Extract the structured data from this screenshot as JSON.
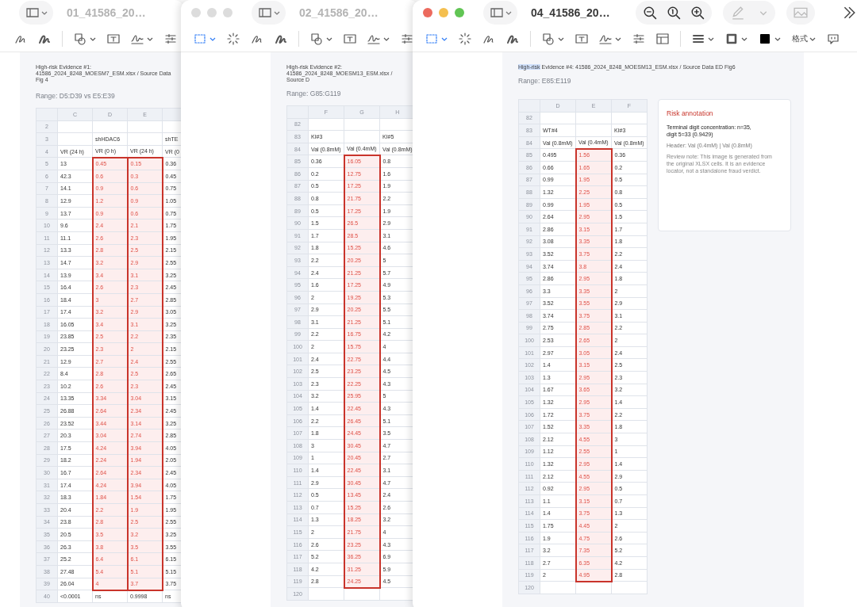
{
  "windows": [
    {
      "title": "01_41586_20…",
      "active": false,
      "evidence": {
        "text": "High-risk Evidence #1: 41586_2024_8248_MOESM7_ESM.xlsx / Source Data Fig 4"
      },
      "range": "Range: D5:D39 vs E5:E39",
      "table": {
        "columns": [
          {
            "letter": "C",
            "flagged": false
          },
          {
            "letter": "D",
            "flagged": true
          },
          {
            "letter": "E",
            "flagged": true
          },
          {
            "flagged": false
          }
        ],
        "rows": [
          {
            "n": "2",
            "flagged": false,
            "cells": [
              null,
              null,
              null,
              null
            ]
          },
          {
            "n": "3",
            "flagged": false,
            "cells": [
              null,
              "shHDAC6",
              null,
              "shTE"
            ]
          },
          {
            "n": "4",
            "flagged": false,
            "cells": [
              "VR (24 h)",
              "VR (0 h)",
              "VR (24 h)",
              "VR (0"
            ]
          },
          {
            "n": "5",
            "flagged": true,
            "cells": [
              "13",
              "0.45",
              "0.15",
              "0.36"
            ]
          },
          {
            "n": "6",
            "flagged": true,
            "cells": [
              "42.3",
              "0.6",
              "0.3",
              "0.45"
            ]
          },
          {
            "n": "7",
            "flagged": true,
            "cells": [
              "14.1",
              "0.9",
              "0.6",
              "0.75"
            ]
          },
          {
            "n": "8",
            "flagged": true,
            "cells": [
              "12.9",
              "1.2",
              "0.9",
              "1.05"
            ]
          },
          {
            "n": "9",
            "flagged": true,
            "cells": [
              "13.7",
              "0.9",
              "0.6",
              "0.75"
            ]
          },
          {
            "n": "10",
            "flagged": true,
            "cells": [
              "9.6",
              "2.4",
              "2.1",
              "1.75"
            ]
          },
          {
            "n": "11",
            "flagged": true,
            "cells": [
              "11.1",
              "2.6",
              "2.3",
              "1.95"
            ]
          },
          {
            "n": "12",
            "flagged": true,
            "cells": [
              "13.3",
              "2.8",
              "2.5",
              "2.15"
            ]
          },
          {
            "n": "13",
            "flagged": true,
            "cells": [
              "14.7",
              "3.2",
              "2.9",
              "2.55"
            ]
          },
          {
            "n": "14",
            "flagged": true,
            "cells": [
              "13.9",
              "3.4",
              "3.1",
              "3.25"
            ]
          },
          {
            "n": "15",
            "flagged": true,
            "cells": [
              "16.4",
              "2.6",
              "2.3",
              "2.45"
            ]
          },
          {
            "n": "16",
            "flagged": true,
            "cells": [
              "18.4",
              "3",
              "2.7",
              "2.85"
            ]
          },
          {
            "n": "17",
            "flagged": true,
            "cells": [
              "17.4",
              "3.2",
              "2.9",
              "3.05"
            ]
          },
          {
            "n": "18",
            "flagged": true,
            "cells": [
              "16.05",
              "3.4",
              "3.1",
              "3.25"
            ]
          },
          {
            "n": "19",
            "flagged": true,
            "cells": [
              "23.85",
              "2.5",
              "2.2",
              "2.35"
            ]
          },
          {
            "n": "20",
            "flagged": true,
            "cells": [
              "23.25",
              "2.3",
              "2",
              "2.15"
            ]
          },
          {
            "n": "21",
            "flagged": true,
            "cells": [
              "12.9",
              "2.7",
              "2.4",
              "2.55"
            ]
          },
          {
            "n": "22",
            "flagged": true,
            "cells": [
              "8.4",
              "2.8",
              "2.5",
              "2.65"
            ]
          },
          {
            "n": "23",
            "flagged": true,
            "cells": [
              "10.2",
              "2.6",
              "2.3",
              "2.45"
            ]
          },
          {
            "n": "24",
            "flagged": true,
            "cells": [
              "13.35",
              "3.34",
              "3.04",
              "3.15"
            ]
          },
          {
            "n": "25",
            "flagged": true,
            "cells": [
              "26.88",
              "2.64",
              "2.34",
              "2.45"
            ]
          },
          {
            "n": "26",
            "flagged": true,
            "cells": [
              "23.52",
              "3.44",
              "3.14",
              "3.25"
            ]
          },
          {
            "n": "27",
            "flagged": true,
            "cells": [
              "20.3",
              "3.04",
              "2.74",
              "2.85"
            ]
          },
          {
            "n": "28",
            "flagged": true,
            "cells": [
              "17.5",
              "4.24",
              "3.94",
              "4.05"
            ]
          },
          {
            "n": "29",
            "flagged": true,
            "cells": [
              "18.2",
              "2.24",
              "1.94",
              "2.05"
            ]
          },
          {
            "n": "30",
            "flagged": true,
            "cells": [
              "16.7",
              "2.64",
              "2.34",
              "2.45"
            ]
          },
          {
            "n": "31",
            "flagged": true,
            "cells": [
              "17.4",
              "4.24",
              "3.94",
              "4.05"
            ]
          },
          {
            "n": "32",
            "flagged": true,
            "cells": [
              "18.3",
              "1.84",
              "1.54",
              "1.75"
            ]
          },
          {
            "n": "33",
            "flagged": true,
            "cells": [
              "20.4",
              "2.2",
              "1.9",
              "1.95"
            ]
          },
          {
            "n": "34",
            "flagged": true,
            "cells": [
              "23.8",
              "2.8",
              "2.5",
              "2.55"
            ]
          },
          {
            "n": "35",
            "flagged": true,
            "cells": [
              "20.5",
              "3.5",
              "3.2",
              "3.25"
            ]
          },
          {
            "n": "36",
            "flagged": true,
            "cells": [
              "26.3",
              "3.8",
              "3.5",
              "3.55"
            ]
          },
          {
            "n": "37",
            "flagged": true,
            "cells": [
              "25.2",
              "6.4",
              "6.1",
              "6.15"
            ]
          },
          {
            "n": "38",
            "flagged": true,
            "cells": [
              "27.48",
              "5.4",
              "5.1",
              "5.15"
            ]
          },
          {
            "n": "39",
            "flagged": true,
            "cells": [
              "26.04",
              "4",
              "3.7",
              "3.75"
            ]
          },
          {
            "n": "40",
            "flagged": false,
            "cells": [
              "<0.0001",
              "ns",
              "0.9998",
              "ns"
            ]
          }
        ]
      }
    },
    {
      "title": "02_41586_20…",
      "active": false,
      "evidence": {
        "text": "High-risk Evidence #2: 41586_2024_8248_MOESM13_ESM.xlsx / Source D"
      },
      "range": "Range: G85:G119",
      "table": {
        "columns": [
          {
            "letter": "F",
            "flagged": false
          },
          {
            "letter": "G",
            "flagged": true
          },
          {
            "letter": "H",
            "flagged": false
          }
        ],
        "rows": [
          {
            "n": "82",
            "flagged": false,
            "cells": [
              null,
              null,
              null
            ]
          },
          {
            "n": "83",
            "flagged": false,
            "cells": [
              "KI#3",
              null,
              "KI#5"
            ]
          },
          {
            "n": "84",
            "flagged": false,
            "cells": [
              "Val (0.8mM)",
              "Val (0.4mM)",
              "Val (0.8mM)"
            ]
          },
          {
            "n": "85",
            "flagged": true,
            "cells": [
              "0.36",
              "16.05",
              "0.8"
            ]
          },
          {
            "n": "86",
            "flagged": true,
            "cells": [
              "0.2",
              "12.75",
              "1.6"
            ]
          },
          {
            "n": "87",
            "flagged": true,
            "cells": [
              "0.5",
              "17.25",
              "1.9"
            ]
          },
          {
            "n": "88",
            "flagged": true,
            "cells": [
              "0.8",
              "21.75",
              "2.2"
            ]
          },
          {
            "n": "89",
            "flagged": true,
            "cells": [
              "0.5",
              "17.25",
              "1.9"
            ]
          },
          {
            "n": "90",
            "flagged": true,
            "cells": [
              "1.5",
              "26.5",
              "2.9"
            ]
          },
          {
            "n": "91",
            "flagged": true,
            "cells": [
              "1.7",
              "28.5",
              "3.1"
            ]
          },
          {
            "n": "92",
            "flagged": true,
            "cells": [
              "1.8",
              "15.25",
              "4.6"
            ]
          },
          {
            "n": "93",
            "flagged": true,
            "cells": [
              "2.2",
              "20.25",
              "5"
            ]
          },
          {
            "n": "94",
            "flagged": true,
            "cells": [
              "2.4",
              "21.25",
              "5.7"
            ]
          },
          {
            "n": "95",
            "flagged": true,
            "cells": [
              "1.6",
              "17.25",
              "4.9"
            ]
          },
          {
            "n": "96",
            "flagged": true,
            "cells": [
              "2",
              "19.25",
              "5.3"
            ]
          },
          {
            "n": "97",
            "flagged": true,
            "cells": [
              "2.9",
              "20.25",
              "5.5"
            ]
          },
          {
            "n": "98",
            "flagged": true,
            "cells": [
              "3.1",
              "21.25",
              "5.1"
            ]
          },
          {
            "n": "99",
            "flagged": true,
            "cells": [
              "2.2",
              "16.75",
              "4.2"
            ]
          },
          {
            "n": "100",
            "flagged": true,
            "cells": [
              "2",
              "15.75",
              "4"
            ]
          },
          {
            "n": "101",
            "flagged": true,
            "cells": [
              "2.4",
              "22.75",
              "4.4"
            ]
          },
          {
            "n": "102",
            "flagged": true,
            "cells": [
              "2.5",
              "23.25",
              "4.5"
            ]
          },
          {
            "n": "103",
            "flagged": true,
            "cells": [
              "2.3",
              "22.25",
              "4.3"
            ]
          },
          {
            "n": "104",
            "flagged": true,
            "cells": [
              "3.2",
              "25.95",
              "5"
            ]
          },
          {
            "n": "105",
            "flagged": true,
            "cells": [
              "1.4",
              "22.45",
              "4.3"
            ]
          },
          {
            "n": "106",
            "flagged": true,
            "cells": [
              "2.2",
              "26.45",
              "5.1"
            ]
          },
          {
            "n": "107",
            "flagged": true,
            "cells": [
              "1.8",
              "24.45",
              "3.5"
            ]
          },
          {
            "n": "108",
            "flagged": true,
            "cells": [
              "3",
              "30.45",
              "4.7"
            ]
          },
          {
            "n": "109",
            "flagged": true,
            "cells": [
              "1",
              "20.45",
              "2.7"
            ]
          },
          {
            "n": "110",
            "flagged": true,
            "cells": [
              "1.4",
              "22.45",
              "3.1"
            ]
          },
          {
            "n": "111",
            "flagged": true,
            "cells": [
              "2.9",
              "30.45",
              "4.7"
            ]
          },
          {
            "n": "112",
            "flagged": true,
            "cells": [
              "0.5",
              "13.45",
              "2.4"
            ]
          },
          {
            "n": "113",
            "flagged": true,
            "cells": [
              "0.7",
              "15.25",
              "2.6"
            ]
          },
          {
            "n": "114",
            "flagged": true,
            "cells": [
              "1.3",
              "18.25",
              "3.2"
            ]
          },
          {
            "n": "115",
            "flagged": true,
            "cells": [
              "2",
              "21.75",
              "4"
            ]
          },
          {
            "n": "116",
            "flagged": true,
            "cells": [
              "2.6",
              "23.25",
              "4.3"
            ]
          },
          {
            "n": "117",
            "flagged": true,
            "cells": [
              "5.2",
              "36.25",
              "6.9"
            ]
          },
          {
            "n": "118",
            "flagged": true,
            "cells": [
              "4.2",
              "31.25",
              "5.9"
            ]
          },
          {
            "n": "119",
            "flagged": true,
            "cells": [
              "2.8",
              "24.25",
              "4.5"
            ]
          },
          {
            "n": "120",
            "flagged": false,
            "cells": [
              null,
              null,
              null
            ]
          }
        ]
      }
    },
    {
      "title": "04_41586_20…",
      "active": true,
      "toolbar": {
        "format_menu": "格式"
      },
      "evidence": {
        "selected_text": "High-risk",
        "text": " Evidence #4: 41586_2024_8248_MOESM13_ESM.xlsx / Source Data ED Fig6"
      },
      "range": "Range: E85:E119",
      "table": {
        "columns": [
          {
            "letter": "D",
            "flagged": false
          },
          {
            "letter": "E",
            "flagged": true
          },
          {
            "letter": "F",
            "flagged": false
          }
        ],
        "rows": [
          {
            "n": "82",
            "flagged": false,
            "cells": [
              null,
              null,
              null
            ]
          },
          {
            "n": "83",
            "flagged": false,
            "cells": [
              "WT#4",
              null,
              "KI#3"
            ]
          },
          {
            "n": "84",
            "flagged": false,
            "cells": [
              "Val (0.8mM)",
              "Val (0.4mM)",
              "Val (0.8mM)"
            ]
          },
          {
            "n": "85",
            "flagged": true,
            "cells": [
              "0.495",
              "1.56",
              "0.36"
            ]
          },
          {
            "n": "86",
            "flagged": true,
            "cells": [
              "0.66",
              "1.65",
              "0.2"
            ]
          },
          {
            "n": "87",
            "flagged": true,
            "cells": [
              "0.99",
              "1.95",
              "0.5"
            ]
          },
          {
            "n": "88",
            "flagged": true,
            "cells": [
              "1.32",
              "2.25",
              "0.8"
            ]
          },
          {
            "n": "89",
            "flagged": true,
            "cells": [
              "0.99",
              "1.95",
              "0.5"
            ]
          },
          {
            "n": "90",
            "flagged": true,
            "cells": [
              "2.64",
              "2.95",
              "1.5"
            ]
          },
          {
            "n": "91",
            "flagged": true,
            "cells": [
              "2.86",
              "3.15",
              "1.7"
            ]
          },
          {
            "n": "92",
            "flagged": true,
            "cells": [
              "3.08",
              "3.35",
              "1.8"
            ]
          },
          {
            "n": "93",
            "flagged": true,
            "cells": [
              "3.52",
              "3.75",
              "2.2"
            ]
          },
          {
            "n": "94",
            "flagged": true,
            "cells": [
              "3.74",
              "3.8",
              "2.4"
            ]
          },
          {
            "n": "95",
            "flagged": true,
            "cells": [
              "2.86",
              "2.95",
              "1.8"
            ]
          },
          {
            "n": "96",
            "flagged": true,
            "cells": [
              "3.3",
              "3.35",
              "2"
            ]
          },
          {
            "n": "97",
            "flagged": true,
            "cells": [
              "3.52",
              "3.55",
              "2.9"
            ]
          },
          {
            "n": "98",
            "flagged": true,
            "cells": [
              "3.74",
              "3.75",
              "3.1"
            ]
          },
          {
            "n": "99",
            "flagged": true,
            "cells": [
              "2.75",
              "2.85",
              "2.2"
            ]
          },
          {
            "n": "100",
            "flagged": true,
            "cells": [
              "2.53",
              "2.65",
              "2"
            ]
          },
          {
            "n": "101",
            "flagged": true,
            "cells": [
              "2.97",
              "3.05",
              "2.4"
            ]
          },
          {
            "n": "102",
            "flagged": true,
            "cells": [
              "1.4",
              "3.15",
              "2.5"
            ]
          },
          {
            "n": "103",
            "flagged": true,
            "cells": [
              "1.3",
              "2.95",
              "2.3"
            ]
          },
          {
            "n": "104",
            "flagged": true,
            "cells": [
              "1.67",
              "3.65",
              "3.2"
            ]
          },
          {
            "n": "105",
            "flagged": true,
            "cells": [
              "1.32",
              "2.95",
              "1.4"
            ]
          },
          {
            "n": "106",
            "flagged": true,
            "cells": [
              "1.72",
              "3.75",
              "2.2"
            ]
          },
          {
            "n": "107",
            "flagged": true,
            "cells": [
              "1.52",
              "3.35",
              "1.8"
            ]
          },
          {
            "n": "108",
            "flagged": true,
            "cells": [
              "2.12",
              "4.55",
              "3"
            ]
          },
          {
            "n": "109",
            "flagged": true,
            "cells": [
              "1.12",
              "2.55",
              "1"
            ]
          },
          {
            "n": "110",
            "flagged": true,
            "cells": [
              "1.32",
              "2.95",
              "1.4"
            ]
          },
          {
            "n": "111",
            "flagged": true,
            "cells": [
              "2.12",
              "4.55",
              "2.9"
            ]
          },
          {
            "n": "112",
            "flagged": true,
            "cells": [
              "0.92",
              "2.95",
              "0.5"
            ]
          },
          {
            "n": "113",
            "flagged": true,
            "cells": [
              "1.1",
              "3.15",
              "0.7"
            ]
          },
          {
            "n": "114",
            "flagged": true,
            "cells": [
              "1.4",
              "3.75",
              "1.3"
            ]
          },
          {
            "n": "115",
            "flagged": true,
            "cells": [
              "1.75",
              "4.45",
              "2"
            ]
          },
          {
            "n": "116",
            "flagged": true,
            "cells": [
              "1.9",
              "4.75",
              "2.6"
            ]
          },
          {
            "n": "117",
            "flagged": true,
            "cells": [
              "3.2",
              "7.35",
              "5.2"
            ]
          },
          {
            "n": "118",
            "flagged": true,
            "cells": [
              "2.7",
              "6.35",
              "4.2"
            ]
          },
          {
            "n": "119",
            "flagged": true,
            "cells": [
              "2",
              "4.95",
              "2.8"
            ]
          },
          {
            "n": "120",
            "flagged": false,
            "cells": [
              null,
              null,
              null
            ]
          }
        ]
      },
      "annotation": {
        "title": "Risk annotation",
        "summary": "Terminal digit concentration: n=35, digit 5=33 (0.9429)",
        "header": "Header: Val (0.4mM) | Val (0.8mM)",
        "note": "Review note: This image is generated from the original XLSX cells. It is an evidence locator, not a standalone fraud verdict."
      }
    }
  ]
}
